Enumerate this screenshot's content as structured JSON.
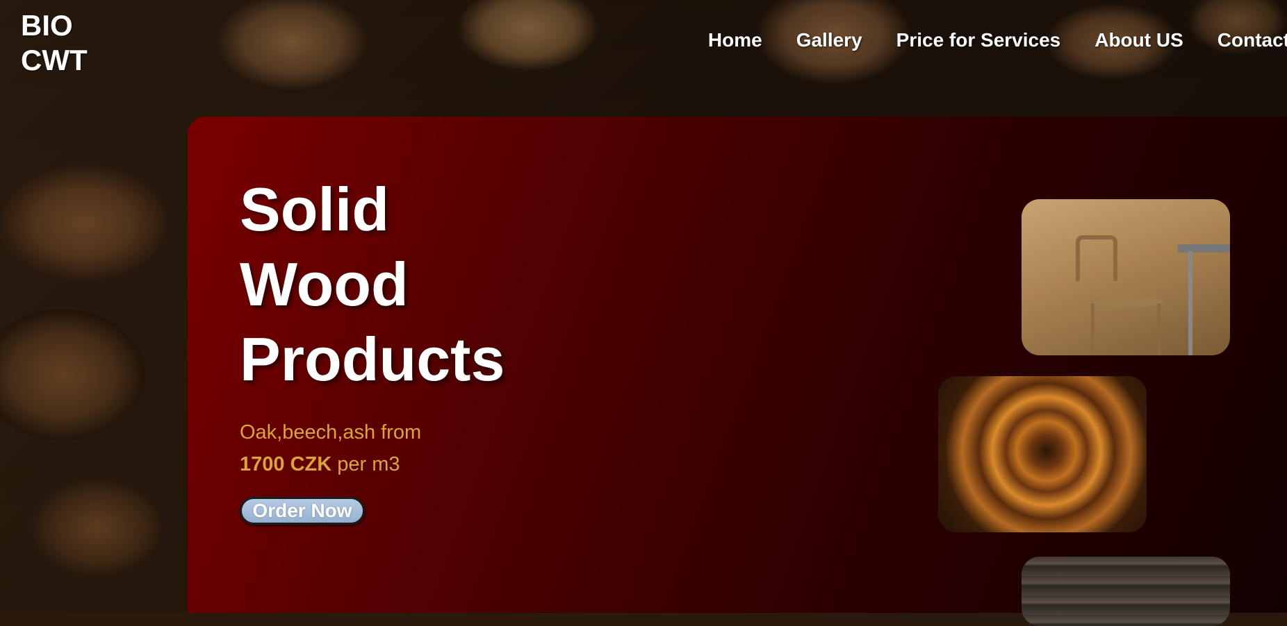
{
  "brand": {
    "line1": "BIO",
    "line2": "CWT"
  },
  "nav": {
    "items": [
      "Home",
      "Gallery",
      "Price for Services",
      "About US",
      "Contact"
    ]
  },
  "hero": {
    "title": [
      "Solid",
      "Wood",
      "Products"
    ],
    "subtitle_line1": "Oak,beech,ash from",
    "price": "1700 CZK",
    "price_suffix": " per m3",
    "cta_label": "Order Now"
  },
  "colors": {
    "hero_gradient_start": "#7a0000",
    "hero_gradient_end": "#120000",
    "accent_text": "#d9a53a",
    "button_bg": "#a8bfdc"
  },
  "images": [
    "chair-photo",
    "spiral-wood-photo",
    "wood-planks-photo"
  ]
}
